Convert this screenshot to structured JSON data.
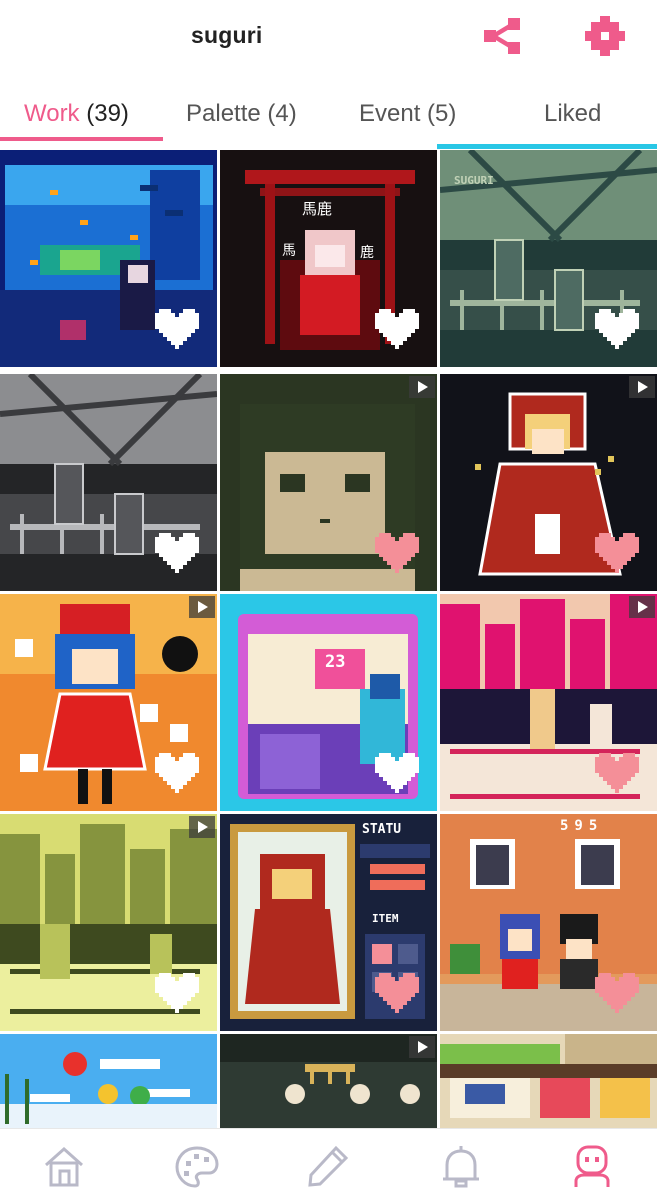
{
  "header": {
    "title": "suguri",
    "icons": [
      "share-icon",
      "gear-icon"
    ],
    "accent_color": "#ef5b8b"
  },
  "tabs": [
    {
      "label": "Work",
      "count": "(39)",
      "active": true
    },
    {
      "label": "Palette",
      "count": "(4)",
      "active": false
    },
    {
      "label": "Event",
      "count": "(5)",
      "active": false
    },
    {
      "label": "Liked",
      "count": "",
      "active": false
    }
  ],
  "grid": {
    "artworks": [
      {
        "theme": "aquarium",
        "liked": false,
        "animated": false
      },
      {
        "theme": "red-shrine",
        "liked": false,
        "animated": false
      },
      {
        "theme": "teal-station",
        "liked": false,
        "animated": false
      },
      {
        "theme": "gray-station",
        "liked": false,
        "animated": false
      },
      {
        "theme": "green-portrait",
        "liked": true,
        "animated": true
      },
      {
        "theme": "red-hood",
        "liked": true,
        "animated": true
      },
      {
        "theme": "orange-shrine-maiden",
        "liked": false,
        "animated": true
      },
      {
        "theme": "claw-machine",
        "liked": false,
        "animated": false
      },
      {
        "theme": "pink-city",
        "liked": true,
        "animated": true
      },
      {
        "theme": "yellow-city",
        "liked": false,
        "animated": true
      },
      {
        "theme": "status-card",
        "liked": true,
        "animated": false
      },
      {
        "theme": "orange-street",
        "liked": true,
        "animated": false
      },
      {
        "theme": "balloons",
        "liked": false,
        "animated": false
      },
      {
        "theme": "dark-chandelier",
        "liked": false,
        "animated": true
      },
      {
        "theme": "market",
        "liked": false,
        "animated": false
      }
    ],
    "text_in_art": {
      "shrine_glyphs": [
        "馬鹿",
        "馬",
        "鹿"
      ],
      "station_sign": "SUGURI",
      "score": "23",
      "status": "STATU",
      "item": "ITEM",
      "shop_sign": "595"
    }
  },
  "bottom_nav": [
    "home-icon",
    "palette-icon",
    "pencil-icon",
    "bell-icon",
    "profile-icon"
  ],
  "colors": {
    "nav_icon": "#b9b9c8",
    "active_icon": "#ef5b8b",
    "liked_heart": "#f48f98",
    "tab_line": "#29c7e6"
  }
}
